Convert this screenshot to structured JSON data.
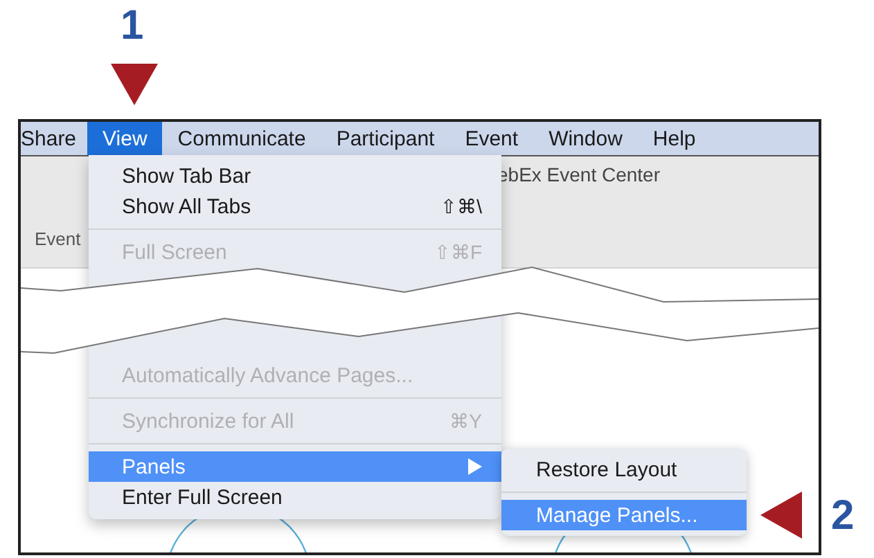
{
  "annotations": [
    {
      "label": "1"
    },
    {
      "label": "2"
    }
  ],
  "menubar": [
    {
      "label": "Share",
      "selected": false
    },
    {
      "label": "View",
      "selected": true
    },
    {
      "label": "Communicate",
      "selected": false
    },
    {
      "label": "Participant",
      "selected": false
    },
    {
      "label": "Event",
      "selected": false
    },
    {
      "label": "Window",
      "selected": false
    },
    {
      "label": "Help",
      "selected": false
    }
  ],
  "window": {
    "title": "ebEx Event Center",
    "tab": "Event"
  },
  "view_menu": [
    {
      "kind": "item",
      "label": "Show Tab Bar",
      "disabled": false,
      "selected": false,
      "submenu": false
    },
    {
      "kind": "item",
      "label": "Show All Tabs",
      "shortcut": "⇧⌘\\",
      "disabled": false,
      "selected": false,
      "submenu": false
    },
    {
      "kind": "separator"
    },
    {
      "kind": "item",
      "label": "Full Screen",
      "shortcut": "⇧⌘F",
      "disabled": true,
      "selected": false,
      "submenu": false
    },
    {
      "kind": "break"
    },
    {
      "kind": "item",
      "label": "Automatically Advance Pages...",
      "disabled": true,
      "selected": false,
      "submenu": false
    },
    {
      "kind": "separator"
    },
    {
      "kind": "item",
      "label": "Synchronize for All",
      "shortcut": "⌘Y",
      "disabled": true,
      "selected": false,
      "submenu": false
    },
    {
      "kind": "separator"
    },
    {
      "kind": "item",
      "label": "Panels",
      "disabled": false,
      "selected": true,
      "submenu": true
    },
    {
      "kind": "item",
      "label": "Enter Full Screen",
      "disabled": false,
      "selected": false,
      "submenu": false
    }
  ],
  "panels_submenu": [
    {
      "kind": "item",
      "label": "Restore Layout",
      "selected": false
    },
    {
      "kind": "separator"
    },
    {
      "kind": "item",
      "label": "Manage Panels...",
      "selected": true
    }
  ]
}
